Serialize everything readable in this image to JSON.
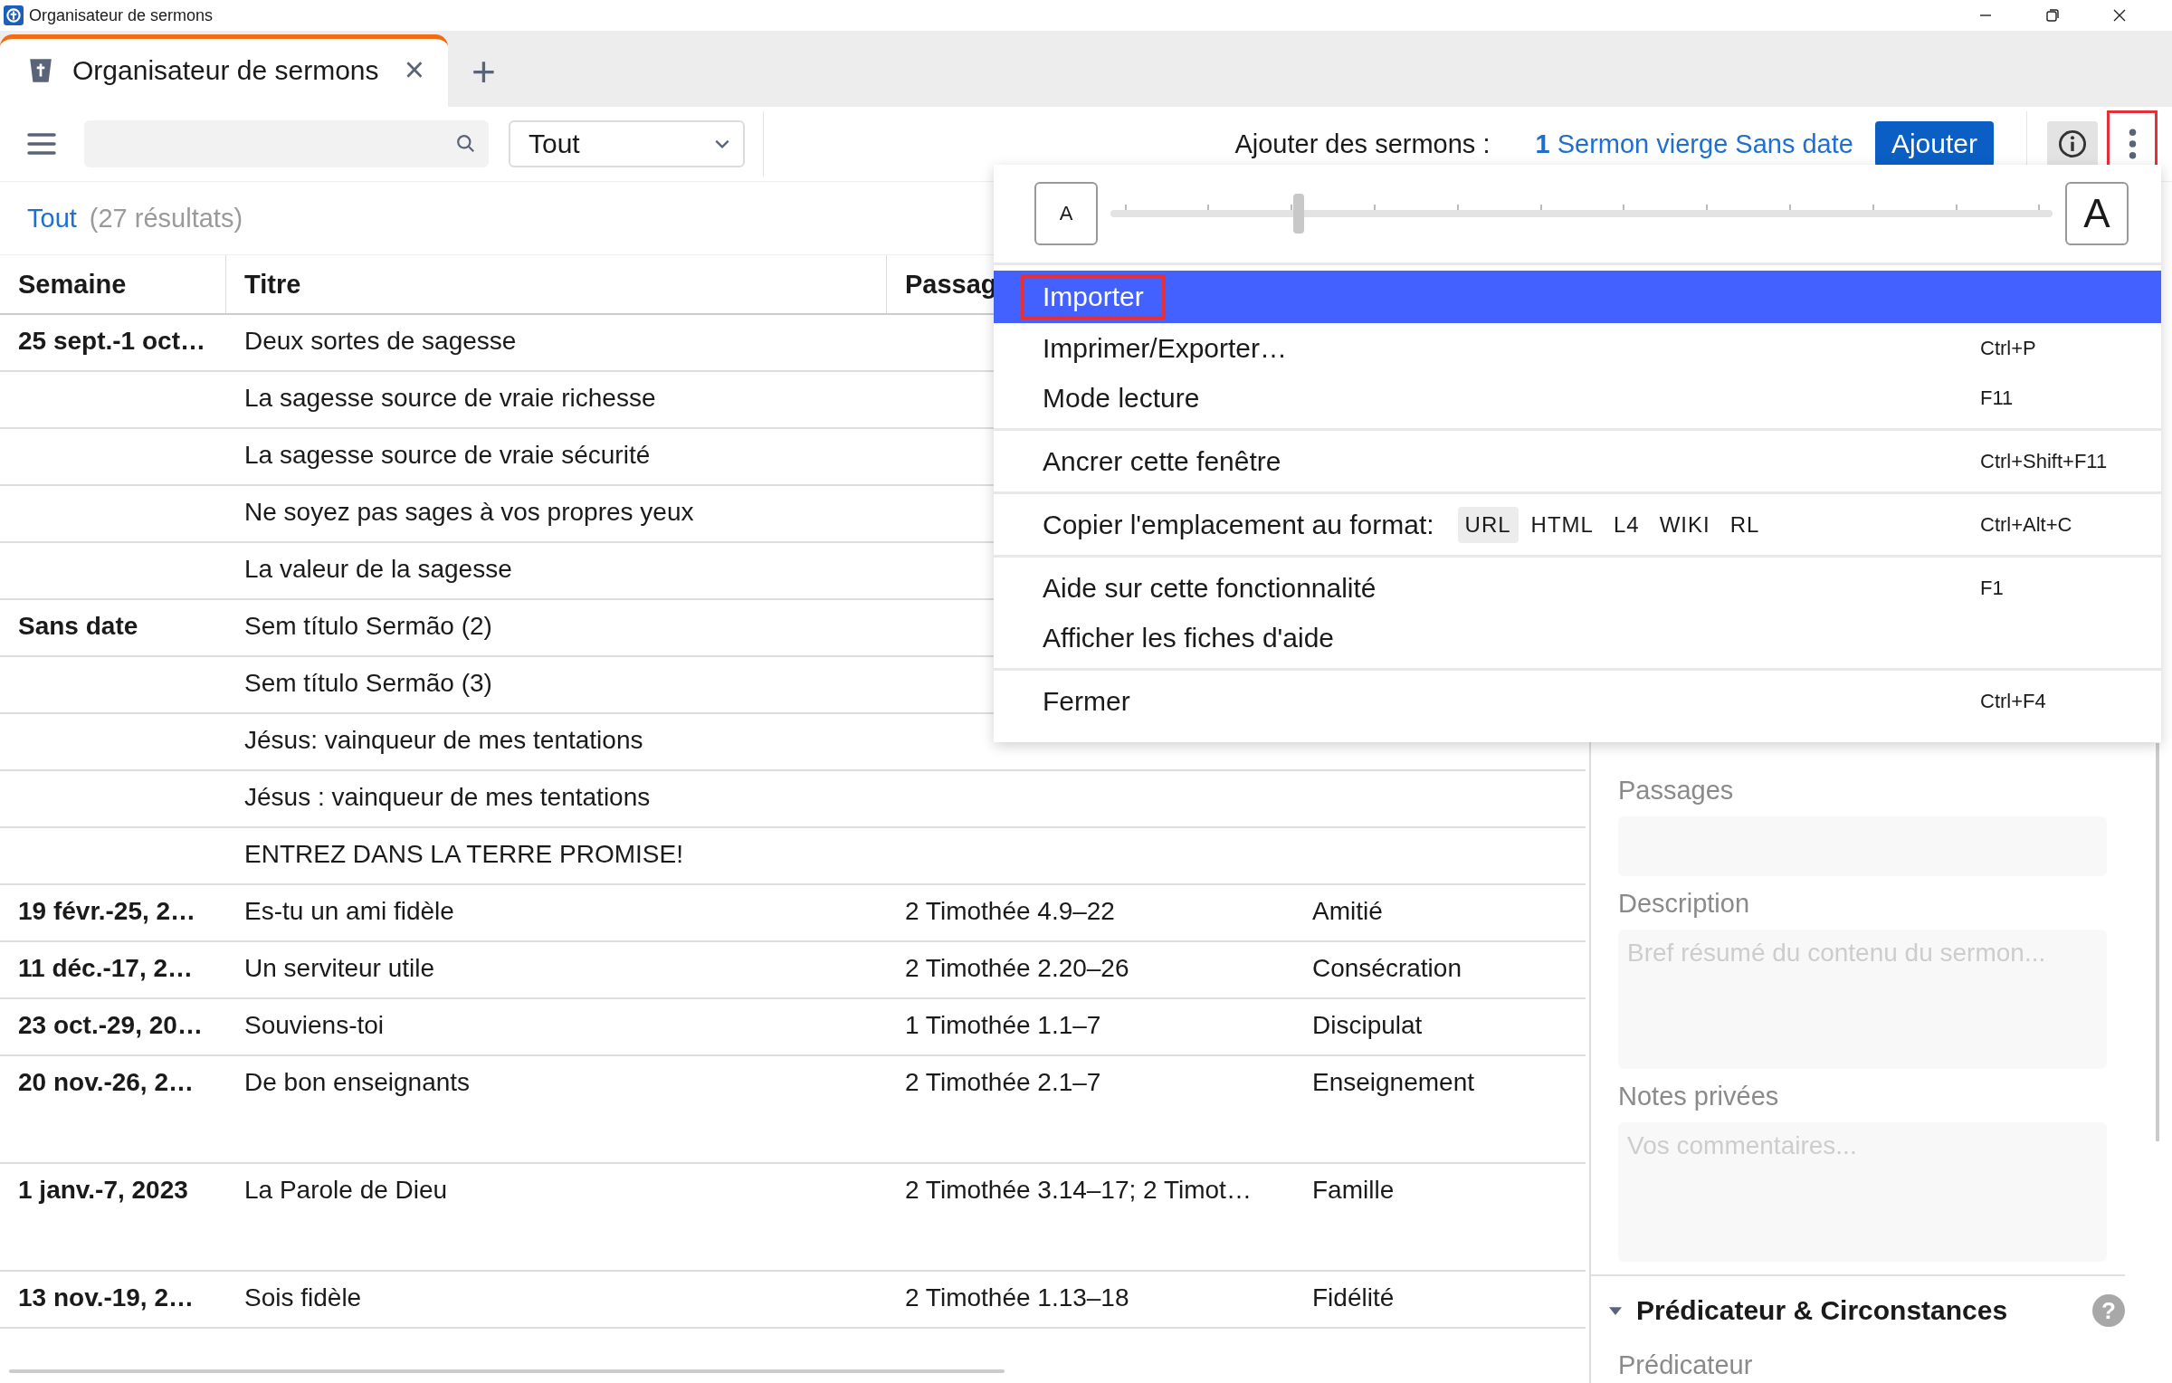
{
  "window": {
    "title": "Organisateur de sermons"
  },
  "tabs": [
    {
      "label": "Organisateur de sermons",
      "selected": true,
      "close": "×"
    }
  ],
  "new_tab": "+",
  "toolbar": {
    "filter": "Tout",
    "add_label": "Ajouter des sermons :",
    "add_link": "**1** Sermon vierge Sans date",
    "add_button": "Ajouter",
    "more_marked": true
  },
  "results": {
    "filter": "Tout",
    "count": "(27 résultats)"
  },
  "table": {
    "columns": [
      "Semaine",
      "Titre",
      "Passag"
    ],
    "rows": [
      {
        "week": "25 sept.-1 oct…",
        "title": "Deux sortes de sagesse",
        "tall": false
      },
      {
        "title": "La sagesse source de vraie richesse",
        "tall": false
      },
      {
        "title": "La sagesse source de vraie sécurité",
        "tall": false
      },
      {
        "title": "Ne soyez pas sages à vos propres yeux",
        "tall": false
      },
      {
        "title": "La valeur de la sagesse",
        "tall": false
      },
      {
        "week": "Sans date",
        "title": "Sem título Sermão (2)",
        "tall": false
      },
      {
        "title": "Sem título Sermão (3)",
        "tall": false
      },
      {
        "title": "Jésus: vainqueur de mes tentations",
        "tall": false
      },
      {
        "title": "Jésus : vainqueur de mes tentations",
        "tall": false
      },
      {
        "title": "ENTREZ DANS LA TERRE PROMISE!",
        "tall": false
      },
      {
        "week": "19 févr.-25, 2…",
        "title": "Es-tu un ami fidèle",
        "passage": "2 Timothée 4.9–22",
        "theme": "Amitié",
        "tall": false
      },
      {
        "week": "11 déc.-17, 2…",
        "title": "Un serviteur utile",
        "passage": "2 Timothée 2.20–26",
        "theme": "Consécration",
        "tall": false
      },
      {
        "week": "23 oct.-29, 20…",
        "title": "Souviens-toi",
        "passage": "1 Timothée 1.1–7",
        "theme": "Discipulat",
        "tall": false
      },
      {
        "week": "20 nov.-26, 2…",
        "title": "De bon enseignants",
        "passage": "2 Timothée 2.1–7",
        "theme": "Enseignement",
        "tall": true
      },
      {
        "week": "1 janv.-7, 2023",
        "title": "La Parole de Dieu",
        "passage": "2 Timothée 3.14–17; 2 Timot…",
        "theme": "Famille",
        "tall": true
      },
      {
        "week": "13 nov.-19, 2…",
        "title": "Sois fidèle",
        "passage": "2 Timothée 1.13–18",
        "theme": "Fidélité",
        "tall": false
      }
    ]
  },
  "menu": {
    "font_size": {
      "small": "A",
      "large": "A",
      "level": 0.2
    },
    "groups": [
      [
        {
          "label": "Importer",
          "selected": true,
          "marked": true
        },
        {
          "label": "Imprimer/Exporter…",
          "shortcut": "Ctrl+P",
          "selected": false,
          "marked": false
        },
        {
          "label": "Mode lecture",
          "shortcut": "F11",
          "selected": false,
          "marked": false
        }
      ],
      [
        {
          "label": "Ancrer cette fenêtre",
          "shortcut": "Ctrl+Shift+F11",
          "selected": false,
          "marked": false
        }
      ],
      [
        {
          "label": "Copier l'emplacement au format:",
          "shortcut": "Ctrl+Alt+C",
          "selected": false,
          "marked": false,
          "formats": [
            {
              "label": "URL",
              "selected": true
            },
            {
              "label": "HTML",
              "selected": false
            },
            {
              "label": "L4",
              "selected": false
            },
            {
              "label": "WIKI",
              "selected": false
            },
            {
              "label": "RL",
              "selected": false
            }
          ]
        }
      ],
      [
        {
          "label": "Aide sur cette fonctionnalité",
          "shortcut": "F1",
          "selected": false,
          "marked": false
        },
        {
          "label": "Afficher les fiches d'aide",
          "selected": false,
          "marked": false
        }
      ],
      [
        {
          "label": "Fermer",
          "shortcut": "Ctrl+F4",
          "selected": false,
          "marked": false
        }
      ]
    ]
  },
  "details": {
    "fields": [
      {
        "label": "Passages",
        "tall": false
      },
      {
        "label": "Description",
        "placeholder": "Bref résumé du contenu du sermon...",
        "tall": true
      },
      {
        "label": "Notes privées",
        "placeholder": "Vos commentaires...",
        "tall": true
      }
    ],
    "section": {
      "title": "Prédicateur & Circonstances",
      "expanded": true,
      "help": "?"
    },
    "next_label": "Prédicateur"
  }
}
